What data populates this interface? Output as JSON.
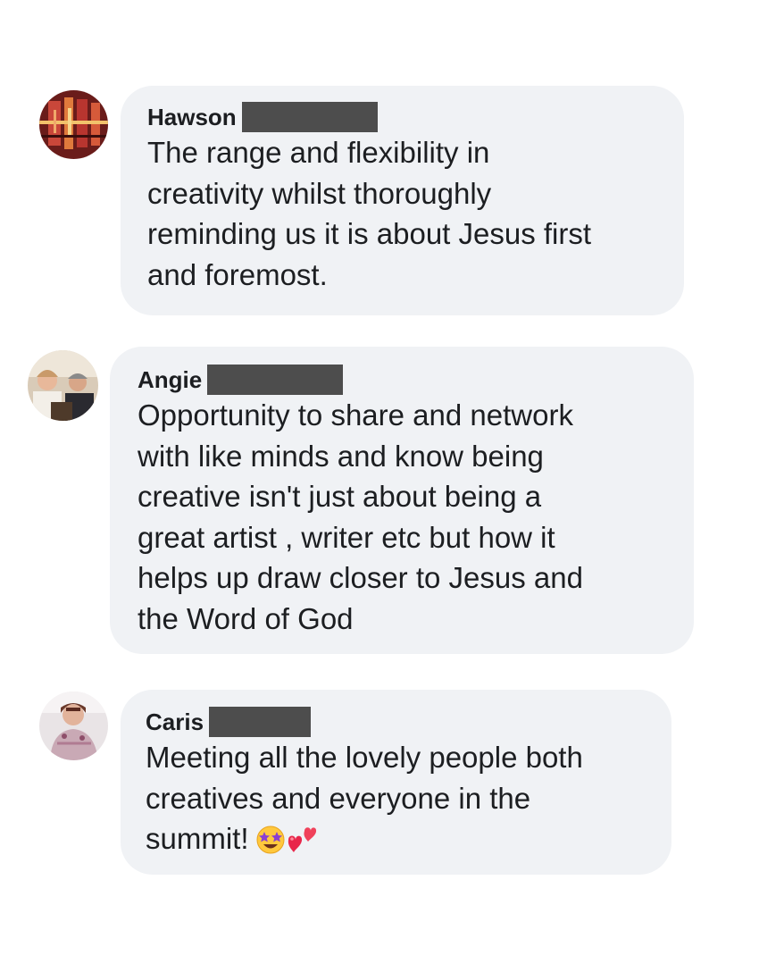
{
  "comments": [
    {
      "author": "Hawson",
      "lines": [
        "The range and flexibility in",
        "creativity whilst thoroughly",
        "reminding us it is about Jesus first",
        "and foremost."
      ]
    },
    {
      "author": "Angie",
      "lines": [
        "Opportunity to share and network",
        "with like minds and know being",
        "creative isn't just about being a",
        "great artist , writer etc but how it",
        "helps up draw closer to Jesus and",
        "the Word of God"
      ]
    },
    {
      "author": "Caris",
      "lines": [
        "Meeting all the lovely people both",
        "creatives and everyone in the",
        "summit!"
      ],
      "emojis": [
        "star-struck-emoji",
        "two-hearts-emoji"
      ]
    }
  ],
  "colors": {
    "bubble": "#f0f2f5",
    "text": "#1c1e21",
    "redaction": "#4d4d4d"
  }
}
